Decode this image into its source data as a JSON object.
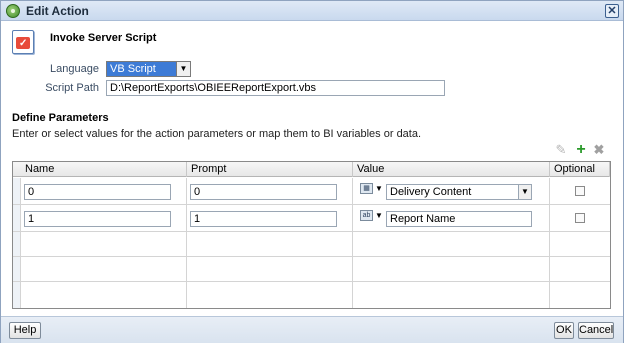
{
  "window": {
    "title": "Edit Action"
  },
  "header": {
    "action_type": "Invoke Server Script",
    "icon": "script-icon"
  },
  "form": {
    "language_label": "Language",
    "language_value": "VB Script",
    "script_path_label": "Script Path",
    "script_path_value": "D:\\ReportExports\\OBIEEReportExport.vbs"
  },
  "params": {
    "section_title": "Define Parameters",
    "description": "Enter or select values for the action parameters or map them to BI variables or data.",
    "columns": {
      "name": "Name",
      "prompt": "Prompt",
      "value": "Value",
      "optional": "Optional"
    },
    "rows": [
      {
        "name": "0",
        "prompt": "0",
        "value": "Delivery Content",
        "value_type": "dropdown",
        "optional": false
      },
      {
        "name": "1",
        "prompt": "1",
        "value": "Report Name",
        "value_type": "text",
        "optional": false
      }
    ]
  },
  "footer": {
    "help": "Help",
    "ok": "OK",
    "cancel": "Cancel"
  }
}
